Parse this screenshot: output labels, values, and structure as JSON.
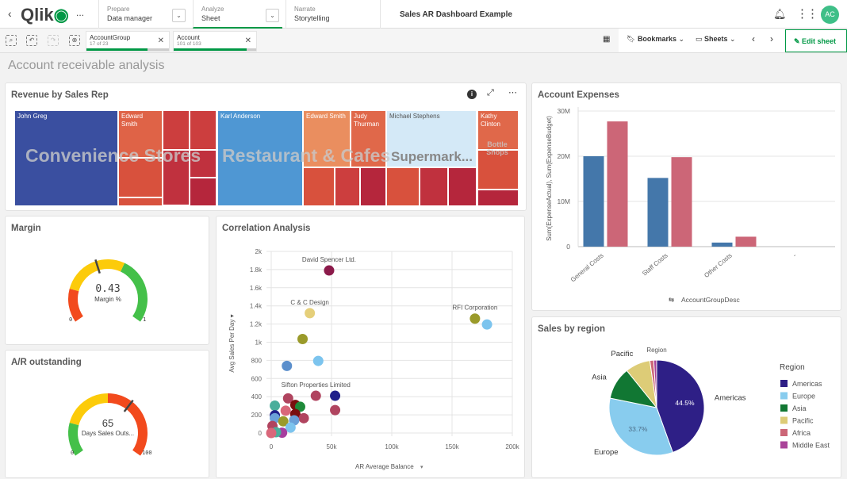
{
  "topbar": {
    "back_icon": "chevron-left-icon",
    "logo": "Qlik",
    "more": "...",
    "tabs": [
      {
        "small": "Prepare",
        "main": "Data manager"
      },
      {
        "small": "Analyze",
        "main": "Sheet"
      },
      {
        "small": "Narrate",
        "main": "Storytelling"
      }
    ],
    "app_title": "Sales AR Dashboard Example",
    "avatar": "AC",
    "accent": "#009845"
  },
  "toolbar": {
    "selections": [
      {
        "field": "AccountGroup",
        "count": "17 of 23",
        "fraction": 0.74
      },
      {
        "field": "Account",
        "count": "101 of 103",
        "fraction": 0.98
      }
    ],
    "bookmarks": "Bookmarks",
    "sheets": "Sheets",
    "edit": "Edit sheet"
  },
  "page_title": "Account receivable analysis",
  "treemap": {
    "title": "Revenue by Sales Rep",
    "groups": [
      "Convenience Stores",
      "Restaurant & Cafes",
      "Supermark...",
      "Bottle Shops"
    ],
    "labels": [
      "John Greg",
      "Edward Smith",
      "Karl Anderson",
      "Edward Smith",
      "Judy Thurman",
      "Michael Stephens",
      "Kathy Clinton"
    ]
  },
  "margin": {
    "title": "Margin",
    "value": "0.43",
    "label": "Margin %",
    "min": "0",
    "max": "1",
    "fraction": 0.43
  },
  "ar": {
    "title": "A/R outstanding",
    "value": "65",
    "label": "Days Sales Outs...",
    "min": "0",
    "max": "100",
    "fraction": 0.65
  },
  "chart_data": [
    {
      "type": "bar",
      "title": "Account Expenses",
      "categories": [
        "General Costs",
        "Staff Costs",
        "Other Costs",
        "-"
      ],
      "series": [
        {
          "values": [
            20,
            15.2,
            0.9,
            0
          ],
          "color": "#4477aa"
        },
        {
          "values": [
            27.7,
            19.8,
            2.2,
            0
          ],
          "color": "#cc6677"
        }
      ],
      "ylabel": "Sum(ExpenseActual), Sum(ExpenseBudget)",
      "xlabel": "AccountGroupDesc",
      "ylim": [
        0,
        30
      ],
      "yticks": [
        "0",
        "10M",
        "20M",
        "30M"
      ],
      "grid": true
    },
    {
      "type": "scatter",
      "title": "Correlation Analysis",
      "xlabel": "AR Average Balance",
      "ylabel": "Avg Sales Per Day",
      "xlim": [
        0,
        200000
      ],
      "ylim": [
        0,
        2000
      ],
      "xticks": [
        "0",
        "50k",
        "100k",
        "150k",
        "200k"
      ],
      "yticks": [
        "0",
        "200",
        "400",
        "600",
        "800",
        "1k",
        "1.2k",
        "1.4k",
        "1.6k",
        "1.8k",
        "2k"
      ],
      "grid": true,
      "points": [
        {
          "x": 48000,
          "y": 1790,
          "c": "#8b1a4a",
          "label": "David Spencer Ltd."
        },
        {
          "x": 32000,
          "y": 1320,
          "c": "#e5cf7a",
          "label": "C & C  Design"
        },
        {
          "x": 169000,
          "y": 1260,
          "c": "#9a9a2a",
          "label": "RFI Corporation"
        },
        {
          "x": 179000,
          "y": 1195,
          "c": "#7cc4ee"
        },
        {
          "x": 26000,
          "y": 1035,
          "c": "#9a9a2a"
        },
        {
          "x": 39000,
          "y": 794,
          "c": "#7cc4ee"
        },
        {
          "x": 13000,
          "y": 739,
          "c": "#5b8fcc"
        },
        {
          "x": 37000,
          "y": 410,
          "c": "#b0445f",
          "label": "Sifton Properties Limited"
        },
        {
          "x": 53000,
          "y": 410,
          "c": "#1f1f8a"
        },
        {
          "x": 53000,
          "y": 252,
          "c": "#b0445f"
        },
        {
          "x": 14000,
          "y": 381,
          "c": "#b0445f"
        },
        {
          "x": 3000,
          "y": 301,
          "c": "#4aae9b"
        },
        {
          "x": 20000,
          "y": 309,
          "c": "#7a0f0f"
        },
        {
          "x": 24000,
          "y": 289,
          "c": "#1f8a3a"
        },
        {
          "x": 12000,
          "y": 246,
          "c": "#d9677a"
        },
        {
          "x": 20000,
          "y": 209,
          "c": "#7a0f0f"
        },
        {
          "x": 27000,
          "y": 163,
          "c": "#b0445f"
        },
        {
          "x": 3000,
          "y": 195,
          "c": "#1f1f8a"
        },
        {
          "x": 3000,
          "y": 163,
          "c": "#6aa0d8"
        },
        {
          "x": 10000,
          "y": 129,
          "c": "#9a9a2a"
        },
        {
          "x": 19000,
          "y": 140,
          "c": "#6aa0d8"
        },
        {
          "x": 16000,
          "y": 60,
          "c": "#7cc4ee"
        },
        {
          "x": 1000,
          "y": 77,
          "c": "#b0445f"
        },
        {
          "x": 9000,
          "y": 3,
          "c": "#a63d9e"
        },
        {
          "x": 4000,
          "y": 9,
          "c": "#4aae9b"
        },
        {
          "x": 0,
          "y": 0,
          "c": "#d9677a"
        }
      ]
    },
    {
      "type": "pie",
      "title": "Sales by region",
      "dimension_label": "Region",
      "legend_title": "Region",
      "legend": "right",
      "slices": [
        {
          "name": "Americas",
          "value": 44.5,
          "c": "#2e1f86",
          "label": "44.5%"
        },
        {
          "name": "Europe",
          "value": 33.7,
          "c": "#88ccee",
          "label": "33.7%"
        },
        {
          "name": "Asia",
          "value": 11.0,
          "c": "#117733"
        },
        {
          "name": "Pacific",
          "value": 8.5,
          "c": "#ddcc77"
        },
        {
          "name": "Africa",
          "value": 1.3,
          "c": "#cc6677"
        },
        {
          "name": "Middle East",
          "value": 1.0,
          "c": "#aa4499"
        }
      ]
    }
  ]
}
